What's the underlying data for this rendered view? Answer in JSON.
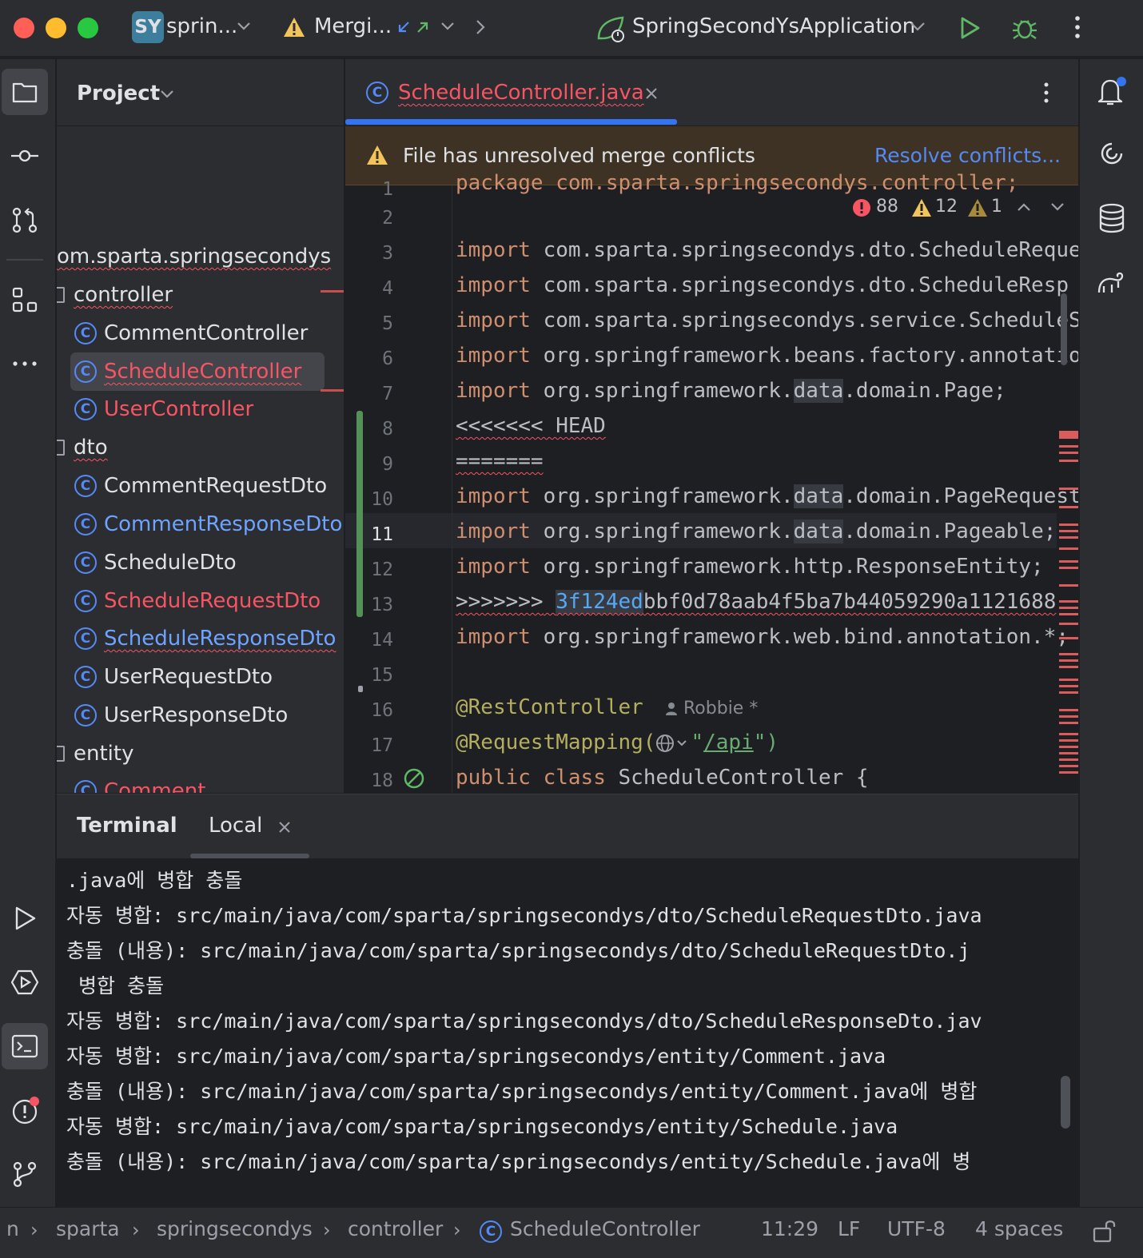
{
  "titlebar": {
    "project_badge": "SY",
    "project_name": "sprin...",
    "vcs_status": "Mergi...",
    "run_config": "SpringSecondYsApplication"
  },
  "project_panel": {
    "title": "Project",
    "tree": {
      "package": "om.sparta.springsecondys",
      "controller_folder": "controller",
      "controller_items": [
        "CommentController",
        "ScheduleController",
        "UserController"
      ],
      "dto_folder": "dto",
      "dto_items": [
        "CommentRequestDto",
        "CommentResponseDto",
        "ScheduleDto",
        "ScheduleRequestDto",
        "ScheduleResponseDto",
        "UserRequestDto",
        "UserResponseDto"
      ],
      "entity_folder": "entity",
      "entity_partial_item": "Comment"
    }
  },
  "editor": {
    "tab_label": "ScheduleController.java",
    "merge_banner": {
      "message": "File has unresolved merge conflicts",
      "action": "Resolve conflicts..."
    },
    "inspections": {
      "errors": "88",
      "warnings": "12",
      "weak_warnings": "1"
    },
    "line_numbers": [
      "1",
      "2",
      "3",
      "4",
      "5",
      "6",
      "7",
      "8",
      "9",
      "10",
      "11",
      "12",
      "13",
      "14",
      "15",
      "16",
      "17",
      "18"
    ],
    "current_line": "11",
    "line1_partial": "package com.sparta.springsecondys.controller;",
    "kw_import": "import",
    "imports": {
      "l3": "com.sparta.springsecondys.dto.ScheduleReque",
      "l4": "com.sparta.springsecondys.dto.ScheduleResp",
      "l5": "com.sparta.springsecondys.service.ScheduleS",
      "l6": "org.springframework.beans.factory.annotatio",
      "l7_pre": "org.springframework.",
      "l7_hl": "data",
      "l7_post": ".domain.Page;",
      "l10_pre": "org.springframework.",
      "l10_hl": "data",
      "l10_post": ".domain.PageRequest",
      "l11_pre": "org.springframework.",
      "l11_hl": "data",
      "l11_post": ".domain.Pageable;",
      "l12": "org.springframework.http.ResponseEntity;",
      "l14": "org.springframework.web.bind.annotation.*;"
    },
    "conflict_head": "<<<<<<< HEAD",
    "conflict_sep": "=======",
    "conflict_end_marker": ">>>>>>>",
    "conflict_end_hash_hl": "3f124ed",
    "conflict_end_hash_rest": "bbf0d78aab4f5ba7b44059290a1121688",
    "annotation_rest": "@RestController",
    "author": "Robbie *",
    "annotation_mapping": "@RequestMapping(",
    "mapping_quote_open": "\"",
    "mapping_path": "/api",
    "mapping_quote_close": "\")",
    "class_kw1": "public",
    "class_kw2": "class",
    "class_name": "ScheduleController {"
  },
  "terminal": {
    "title": "Terminal",
    "tab_label": "Local",
    "lines": [
      ".java에 병합 충돌",
      "자동 병합: src/main/java/com/sparta/springsecondys/dto/ScheduleRequestDto.java",
      "충돌 (내용): src/main/java/com/sparta/springsecondys/dto/ScheduleRequestDto.j",
      " 병합 충돌",
      "자동 병합: src/main/java/com/sparta/springsecondys/dto/ScheduleResponseDto.jav",
      "자동 병합: src/main/java/com/sparta/springsecondys/entity/Comment.java",
      "충돌 (내용): src/main/java/com/sparta/springsecondys/entity/Comment.java에 병합",
      "자동 병합: src/main/java/com/sparta/springsecondys/entity/Schedule.java",
      "충돌 (내용): src/main/java/com/sparta/springsecondys/entity/Schedule.java에 병"
    ]
  },
  "statusbar": {
    "breadcrumb": [
      "n",
      "sparta",
      "springsecondys",
      "controller",
      "ScheduleController"
    ],
    "position": "11:29",
    "line_ending": "LF",
    "encoding": "UTF-8",
    "indent": "4 spaces"
  },
  "colors": {
    "accent": "#3574f0",
    "error": "#f75464",
    "warning": "#f2c55c",
    "keyword": "#cf8e6d",
    "annotation": "#b3ae60"
  }
}
